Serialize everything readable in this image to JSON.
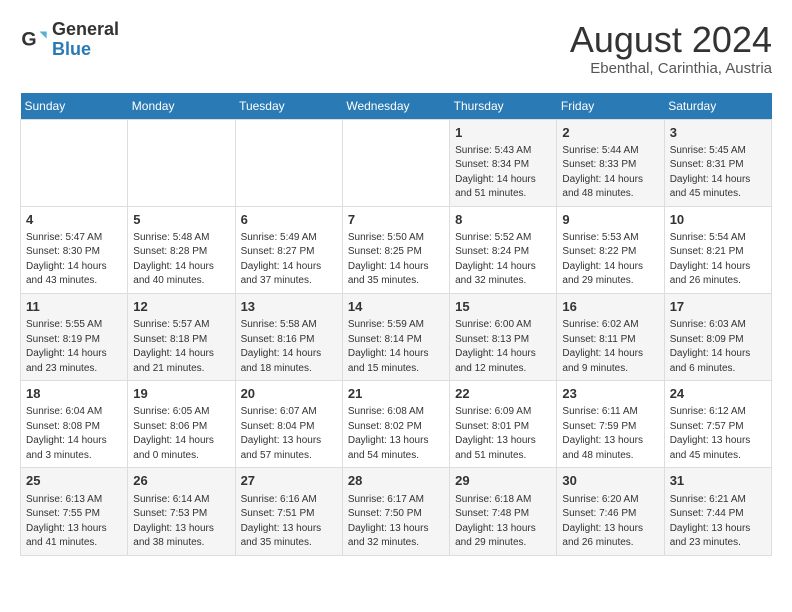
{
  "logo": {
    "general": "General",
    "blue": "Blue"
  },
  "title": {
    "month_year": "August 2024",
    "location": "Ebenthal, Carinthia, Austria"
  },
  "weekdays": [
    "Sunday",
    "Monday",
    "Tuesday",
    "Wednesday",
    "Thursday",
    "Friday",
    "Saturday"
  ],
  "weeks": [
    [
      {
        "day": "",
        "info": ""
      },
      {
        "day": "",
        "info": ""
      },
      {
        "day": "",
        "info": ""
      },
      {
        "day": "",
        "info": ""
      },
      {
        "day": "1",
        "info": "Sunrise: 5:43 AM\nSunset: 8:34 PM\nDaylight: 14 hours\nand 51 minutes."
      },
      {
        "day": "2",
        "info": "Sunrise: 5:44 AM\nSunset: 8:33 PM\nDaylight: 14 hours\nand 48 minutes."
      },
      {
        "day": "3",
        "info": "Sunrise: 5:45 AM\nSunset: 8:31 PM\nDaylight: 14 hours\nand 45 minutes."
      }
    ],
    [
      {
        "day": "4",
        "info": "Sunrise: 5:47 AM\nSunset: 8:30 PM\nDaylight: 14 hours\nand 43 minutes."
      },
      {
        "day": "5",
        "info": "Sunrise: 5:48 AM\nSunset: 8:28 PM\nDaylight: 14 hours\nand 40 minutes."
      },
      {
        "day": "6",
        "info": "Sunrise: 5:49 AM\nSunset: 8:27 PM\nDaylight: 14 hours\nand 37 minutes."
      },
      {
        "day": "7",
        "info": "Sunrise: 5:50 AM\nSunset: 8:25 PM\nDaylight: 14 hours\nand 35 minutes."
      },
      {
        "day": "8",
        "info": "Sunrise: 5:52 AM\nSunset: 8:24 PM\nDaylight: 14 hours\nand 32 minutes."
      },
      {
        "day": "9",
        "info": "Sunrise: 5:53 AM\nSunset: 8:22 PM\nDaylight: 14 hours\nand 29 minutes."
      },
      {
        "day": "10",
        "info": "Sunrise: 5:54 AM\nSunset: 8:21 PM\nDaylight: 14 hours\nand 26 minutes."
      }
    ],
    [
      {
        "day": "11",
        "info": "Sunrise: 5:55 AM\nSunset: 8:19 PM\nDaylight: 14 hours\nand 23 minutes."
      },
      {
        "day": "12",
        "info": "Sunrise: 5:57 AM\nSunset: 8:18 PM\nDaylight: 14 hours\nand 21 minutes."
      },
      {
        "day": "13",
        "info": "Sunrise: 5:58 AM\nSunset: 8:16 PM\nDaylight: 14 hours\nand 18 minutes."
      },
      {
        "day": "14",
        "info": "Sunrise: 5:59 AM\nSunset: 8:14 PM\nDaylight: 14 hours\nand 15 minutes."
      },
      {
        "day": "15",
        "info": "Sunrise: 6:00 AM\nSunset: 8:13 PM\nDaylight: 14 hours\nand 12 minutes."
      },
      {
        "day": "16",
        "info": "Sunrise: 6:02 AM\nSunset: 8:11 PM\nDaylight: 14 hours\nand 9 minutes."
      },
      {
        "day": "17",
        "info": "Sunrise: 6:03 AM\nSunset: 8:09 PM\nDaylight: 14 hours\nand 6 minutes."
      }
    ],
    [
      {
        "day": "18",
        "info": "Sunrise: 6:04 AM\nSunset: 8:08 PM\nDaylight: 14 hours\nand 3 minutes."
      },
      {
        "day": "19",
        "info": "Sunrise: 6:05 AM\nSunset: 8:06 PM\nDaylight: 14 hours\nand 0 minutes."
      },
      {
        "day": "20",
        "info": "Sunrise: 6:07 AM\nSunset: 8:04 PM\nDaylight: 13 hours\nand 57 minutes."
      },
      {
        "day": "21",
        "info": "Sunrise: 6:08 AM\nSunset: 8:02 PM\nDaylight: 13 hours\nand 54 minutes."
      },
      {
        "day": "22",
        "info": "Sunrise: 6:09 AM\nSunset: 8:01 PM\nDaylight: 13 hours\nand 51 minutes."
      },
      {
        "day": "23",
        "info": "Sunrise: 6:11 AM\nSunset: 7:59 PM\nDaylight: 13 hours\nand 48 minutes."
      },
      {
        "day": "24",
        "info": "Sunrise: 6:12 AM\nSunset: 7:57 PM\nDaylight: 13 hours\nand 45 minutes."
      }
    ],
    [
      {
        "day": "25",
        "info": "Sunrise: 6:13 AM\nSunset: 7:55 PM\nDaylight: 13 hours\nand 41 minutes."
      },
      {
        "day": "26",
        "info": "Sunrise: 6:14 AM\nSunset: 7:53 PM\nDaylight: 13 hours\nand 38 minutes."
      },
      {
        "day": "27",
        "info": "Sunrise: 6:16 AM\nSunset: 7:51 PM\nDaylight: 13 hours\nand 35 minutes."
      },
      {
        "day": "28",
        "info": "Sunrise: 6:17 AM\nSunset: 7:50 PM\nDaylight: 13 hours\nand 32 minutes."
      },
      {
        "day": "29",
        "info": "Sunrise: 6:18 AM\nSunset: 7:48 PM\nDaylight: 13 hours\nand 29 minutes."
      },
      {
        "day": "30",
        "info": "Sunrise: 6:20 AM\nSunset: 7:46 PM\nDaylight: 13 hours\nand 26 minutes."
      },
      {
        "day": "31",
        "info": "Sunrise: 6:21 AM\nSunset: 7:44 PM\nDaylight: 13 hours\nand 23 minutes."
      }
    ]
  ]
}
